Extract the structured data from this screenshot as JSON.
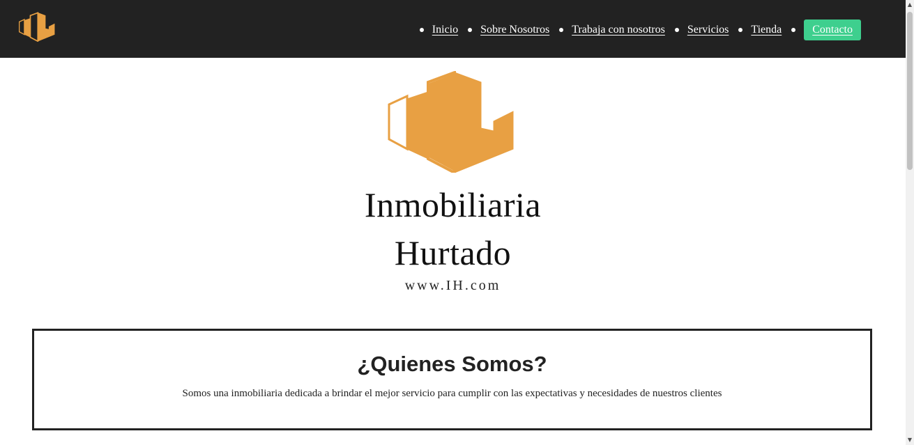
{
  "header": {
    "logo_icon": "buildings-logo-icon",
    "nav": [
      {
        "label": "Inicio"
      },
      {
        "label": "Sobre Nosotros"
      },
      {
        "label": "Trabaja con nosotros"
      },
      {
        "label": "Servicios"
      },
      {
        "label": "Tienda"
      }
    ],
    "contact_label": "Contacto"
  },
  "hero": {
    "logo_icon": "buildings-logo-icon",
    "brand_line_1": "Inmobiliaria",
    "brand_line_2": "Hurtado",
    "url": "www.IH.com"
  },
  "about": {
    "title": "¿Quienes Somos?",
    "text": "Somos una inmobiliaria dedicada a brindar el mejor servicio para cumplir con las expectativas y necesidades de nuestros clientes"
  },
  "colors": {
    "header_bg": "#222222",
    "logo_gold": "#E8A043",
    "contact_green": "#3ECF8E",
    "text_dark": "#222222"
  }
}
